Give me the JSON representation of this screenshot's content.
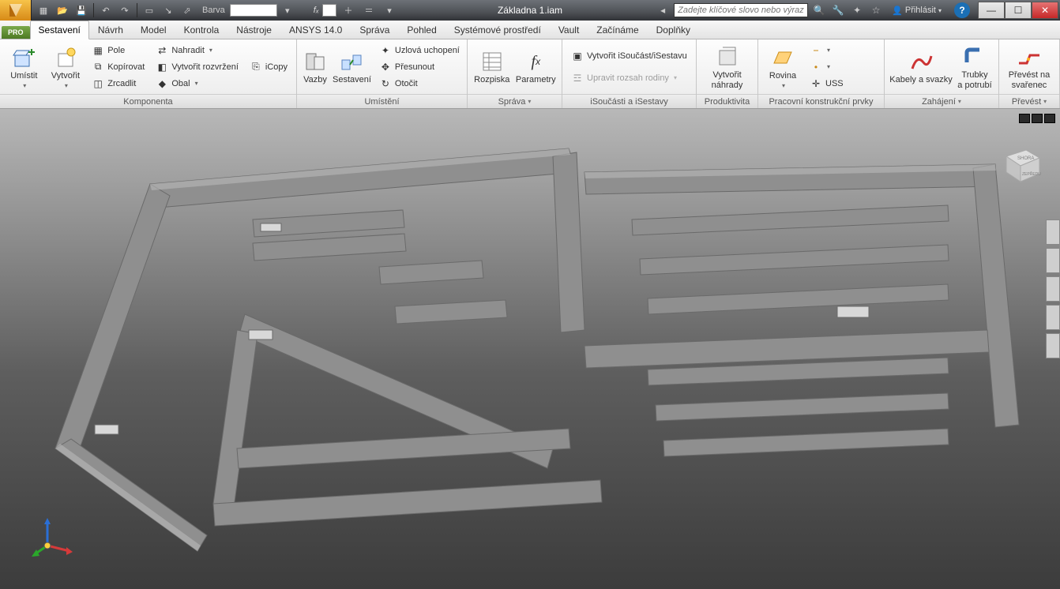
{
  "title": "Základna 1.iam",
  "qat": {
    "color_label": "Barva",
    "fx_label": "fₓ"
  },
  "search": {
    "placeholder": "Zadejte klíčové slovo nebo výraz."
  },
  "signin": "Přihlásit",
  "app_badge": "PRO",
  "tabs": [
    "Sestavení",
    "Návrh",
    "Model",
    "Kontrola",
    "Nástroje",
    "ANSYS 14.0",
    "Správa",
    "Pohled",
    "Systémové prostředí",
    "Vault",
    "Začínáme",
    "Doplňky"
  ],
  "active_tab_index": 0,
  "panels": {
    "komponenta": {
      "title": "Komponenta",
      "umistit": "Umístit",
      "vytvorit": "Vytvořit",
      "pole": "Pole",
      "kopirovat": "Kopírovat",
      "zrcadlit": "Zrcadlit",
      "nahradit": "Nahradit",
      "vytvorit_rozvrzeni": "Vytvořit rozvržení",
      "obal": "Obal",
      "icopy": "iCopy"
    },
    "umisteni": {
      "title": "Umístění",
      "vazby": "Vazby",
      "sestaveni": "Sestavení",
      "uzlova": "Uzlová uchopení",
      "presunout": "Přesunout",
      "otocit": "Otočit"
    },
    "sprava": {
      "title": "Správa",
      "rozpiska": "Rozpiska",
      "parametry": "Parametry"
    },
    "isoucasti": {
      "title": "iSoučásti a iSestavy",
      "vytvorit_isouc": "Vytvořit iSoučást/iSestavu",
      "upravit": "Upravit rozsah rodiny"
    },
    "produktivita": {
      "title": "Produktivita",
      "vytvorit_nahrady_l1": "Vytvořit",
      "vytvorit_nahrady_l2": "náhrady"
    },
    "pracovni": {
      "title": "Pracovní konstrukční prvky",
      "rovina": "Rovina",
      "uss": "USS"
    },
    "zahajeni": {
      "title": "Zahájení",
      "kabely": "Kabely a svazky",
      "trubky_l1": "Trubky",
      "trubky_l2": "a potrubí"
    },
    "prevest": {
      "title": "Převést",
      "prevest_l1": "Převést na",
      "prevest_l2": "svařenec"
    }
  },
  "viewcube": {
    "top": "SHORA",
    "front": "ZEPŘEDU"
  }
}
